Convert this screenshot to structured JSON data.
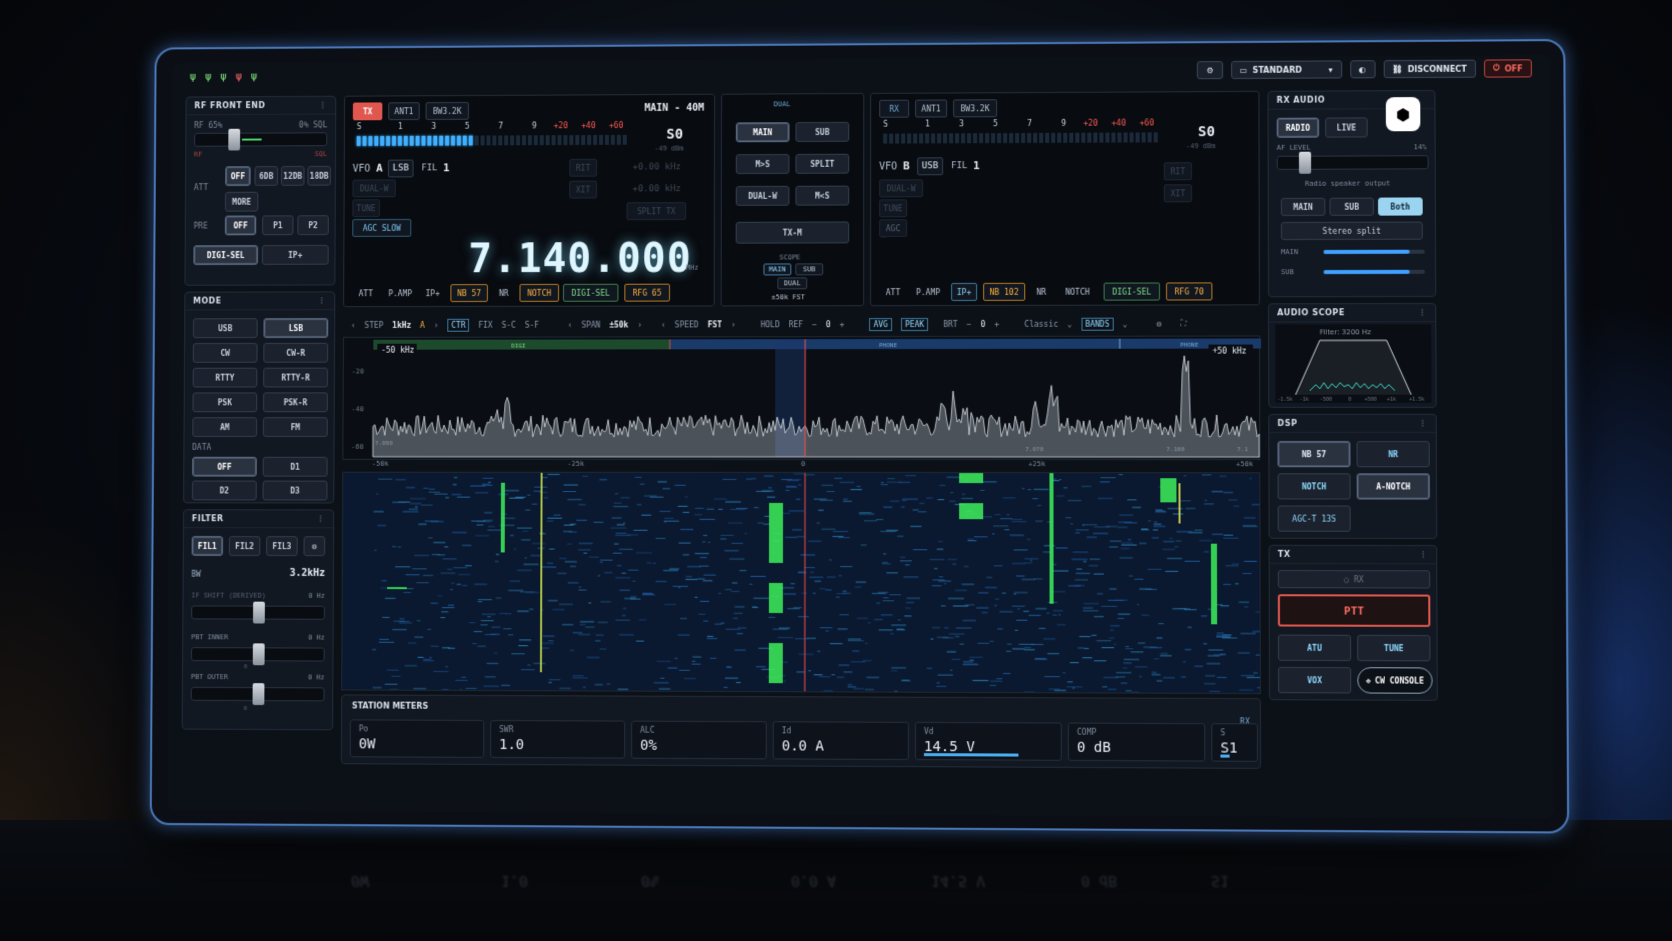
{
  "topbar": {
    "status_icons": [
      "ψ",
      "ψ",
      "ψ",
      "ψ",
      "ψ"
    ],
    "profile": "STANDARD",
    "disconnect": "DISCONNECT",
    "power": "OFF"
  },
  "rf_front_end": {
    "title": "RF FRONT END",
    "rf_label": "RF 65%",
    "sql_label": "0% SQL",
    "rf_value": 0.65,
    "sql_value": 0,
    "rf_short": "RF",
    "sql_short": "SQL",
    "att_label": "ATT",
    "att_options": [
      "OFF",
      "6DB",
      "12DB",
      "18DB"
    ],
    "more": "MORE",
    "pre_label": "PRE",
    "pre_options": [
      "OFF",
      "P1",
      "P2"
    ],
    "digi_sel": "DIGI-SEL",
    "ip_plus": "IP+"
  },
  "mode": {
    "title": "MODE",
    "options": [
      "USB",
      "LSB",
      "CW",
      "CW-R",
      "RTTY",
      "RTTY-R",
      "PSK",
      "PSK-R",
      "AM",
      "FM"
    ],
    "data_label": "DATA",
    "data_options": [
      "OFF",
      "D1",
      "D2",
      "D3"
    ]
  },
  "filter": {
    "title": "FILTER",
    "options": [
      "FIL1",
      "FIL2",
      "FIL3"
    ],
    "bw_label": "BW",
    "bw_value": "3.2kHz",
    "if_shift_label": "IF SHIFT (DERIVED)",
    "if_shift_value": "0 Hz",
    "pbt_inner_label": "PBT INNER",
    "pbt_inner_value": "0 Hz",
    "pbt_outer_label": "PBT OUTER",
    "pbt_outer_value": "0 Hz",
    "slider_zero": "0"
  },
  "vfo_a": {
    "tx": "TX",
    "ant": "ANT1",
    "bw": "BW3.2K",
    "band": "MAIN - 40M",
    "s_scale": [
      "S",
      "1",
      "3",
      "5",
      "7",
      "9",
      "+20",
      "+40",
      "+60"
    ],
    "s_reading": "S0",
    "dbm": "-49 dBm",
    "meter_level": 0.42,
    "vfo_label": "VFO",
    "vfo_letter": "A",
    "mode": "LSB",
    "fil_label": "FIL",
    "fil_num": "1",
    "rit": "RIT",
    "rit_val": "+0.00 kHz",
    "xit": "XIT",
    "xit_val": "+0.00 kHz",
    "dual_w": "DUAL-W",
    "tune": "TUNE",
    "split_tx": "SPLIT TX",
    "agc": "AGC SLOW",
    "frequency": "7.140.000",
    "unit": "MHz",
    "bottom": [
      "ATT",
      "P.AMP",
      "IP+",
      "NB 57",
      "NR",
      "NOTCH",
      "DIGI-SEL",
      "RFG 65"
    ]
  },
  "dual": {
    "title": "DUAL",
    "buttons": [
      "MAIN",
      "SUB",
      "M>S",
      "SPLIT",
      "DUAL-W",
      "M<S"
    ],
    "tx_m": "TX-M",
    "scope_label": "SCOPE",
    "scope_opts": [
      "MAIN",
      "SUB"
    ],
    "scope_dual": "DUAL",
    "scope_info": "±50k FST"
  },
  "vfo_b": {
    "rx": "RX",
    "ant": "ANT1",
    "bw": "BW3.2K",
    "s_scale": [
      "S",
      "1",
      "3",
      "5",
      "7",
      "9",
      "+20",
      "+40",
      "+60"
    ],
    "s_reading": "S0",
    "dbm": "-49 dBm",
    "vfo_label": "VFO",
    "vfo_letter": "B",
    "mode": "USB",
    "fil_label": "FIL",
    "fil_num": "1",
    "rit": "RIT",
    "xit": "XIT",
    "dual_w": "DUAL-W",
    "tune": "TUNE",
    "agc": "AGC",
    "bottom": [
      "ATT",
      "P.AMP",
      "IP+",
      "NB 102",
      "NR",
      "NOTCH",
      "DIGI-SEL",
      "RFG 70"
    ]
  },
  "scope_bar": {
    "step_label": "STEP",
    "step": "1kHz",
    "step_marker": "A",
    "ctr": "CTR",
    "fix": "FIX",
    "sc": "S-C",
    "sf": "S-F",
    "span_label": "SPAN",
    "span": "±50k",
    "speed_label": "SPEED",
    "speed": "FST",
    "hold": "HOLD",
    "ref_label": "REF",
    "ref": "0",
    "avg": "AVG",
    "peak": "PEAK",
    "brt_label": "BRT",
    "brt": "0",
    "theme": "Classic",
    "bands": "BANDS"
  },
  "spectrum": {
    "left_marker": "-50 kHz",
    "right_marker": "+50 kHz",
    "seg_digi": "DIGI",
    "seg_phone": "PHONE",
    "seg_phone2": "PHONE",
    "db_ticks": [
      "-20",
      "-40",
      "-60"
    ],
    "freq_ticks": [
      "-50k",
      "-25k",
      "0",
      "+25k",
      "+50k"
    ],
    "edge_left": "7.090",
    "edge_mid1": "7.070",
    "edge_mid2": "7.100",
    "edge_right": "7.1"
  },
  "station_meters": {
    "title": "STATION METERS",
    "rx": "RX",
    "meters": [
      {
        "label": "Po",
        "value": "0W",
        "level": 0
      },
      {
        "label": "SWR",
        "value": "1.0",
        "level": 0
      },
      {
        "label": "ALC",
        "value": "0%",
        "level": 0
      },
      {
        "label": "Id",
        "value": "0.0 A",
        "level": 0
      },
      {
        "label": "Vd",
        "value": "14.5 V",
        "level": 0.72
      },
      {
        "label": "COMP",
        "value": "0 dB",
        "level": 0
      },
      {
        "label": "S",
        "value": "S1",
        "level": 0.3
      }
    ]
  },
  "rx_audio": {
    "title": "RX AUDIO",
    "radio": "RADIO",
    "live": "LIVE",
    "af_label": "AF LEVEL",
    "af_value": "14%",
    "af_level": 0.14,
    "output_label": "Radio speaker output",
    "routes": [
      "MAIN",
      "SUB",
      "Both"
    ],
    "stereo": "Stereo split",
    "main_label": "MAIN",
    "sub_label": "SUB",
    "main_level": 0.85,
    "sub_level": 0.85
  },
  "audio_scope": {
    "title": "AUDIO SCOPE",
    "filter": "Filter: 3200 Hz",
    "ticks": [
      "-1.5k",
      "-1k",
      "-500",
      "0",
      "+500",
      "+1k",
      "+1.5k"
    ]
  },
  "dsp": {
    "title": "DSP",
    "buttons": [
      "NB 57",
      "NR",
      "NOTCH",
      "A-NOTCH",
      "AGC-T 13S"
    ]
  },
  "tx": {
    "title": "TX",
    "rx_state": "○ RX",
    "ptt": "PTT",
    "atu": "ATU",
    "tune": "TUNE",
    "vox": "VOX",
    "cw_console": "CW CONSOLE"
  },
  "colors": {
    "accent": "#3fb0ff",
    "tx_red": "#e0574f",
    "warn": "#ffb23e",
    "ok": "#7fe08a"
  }
}
